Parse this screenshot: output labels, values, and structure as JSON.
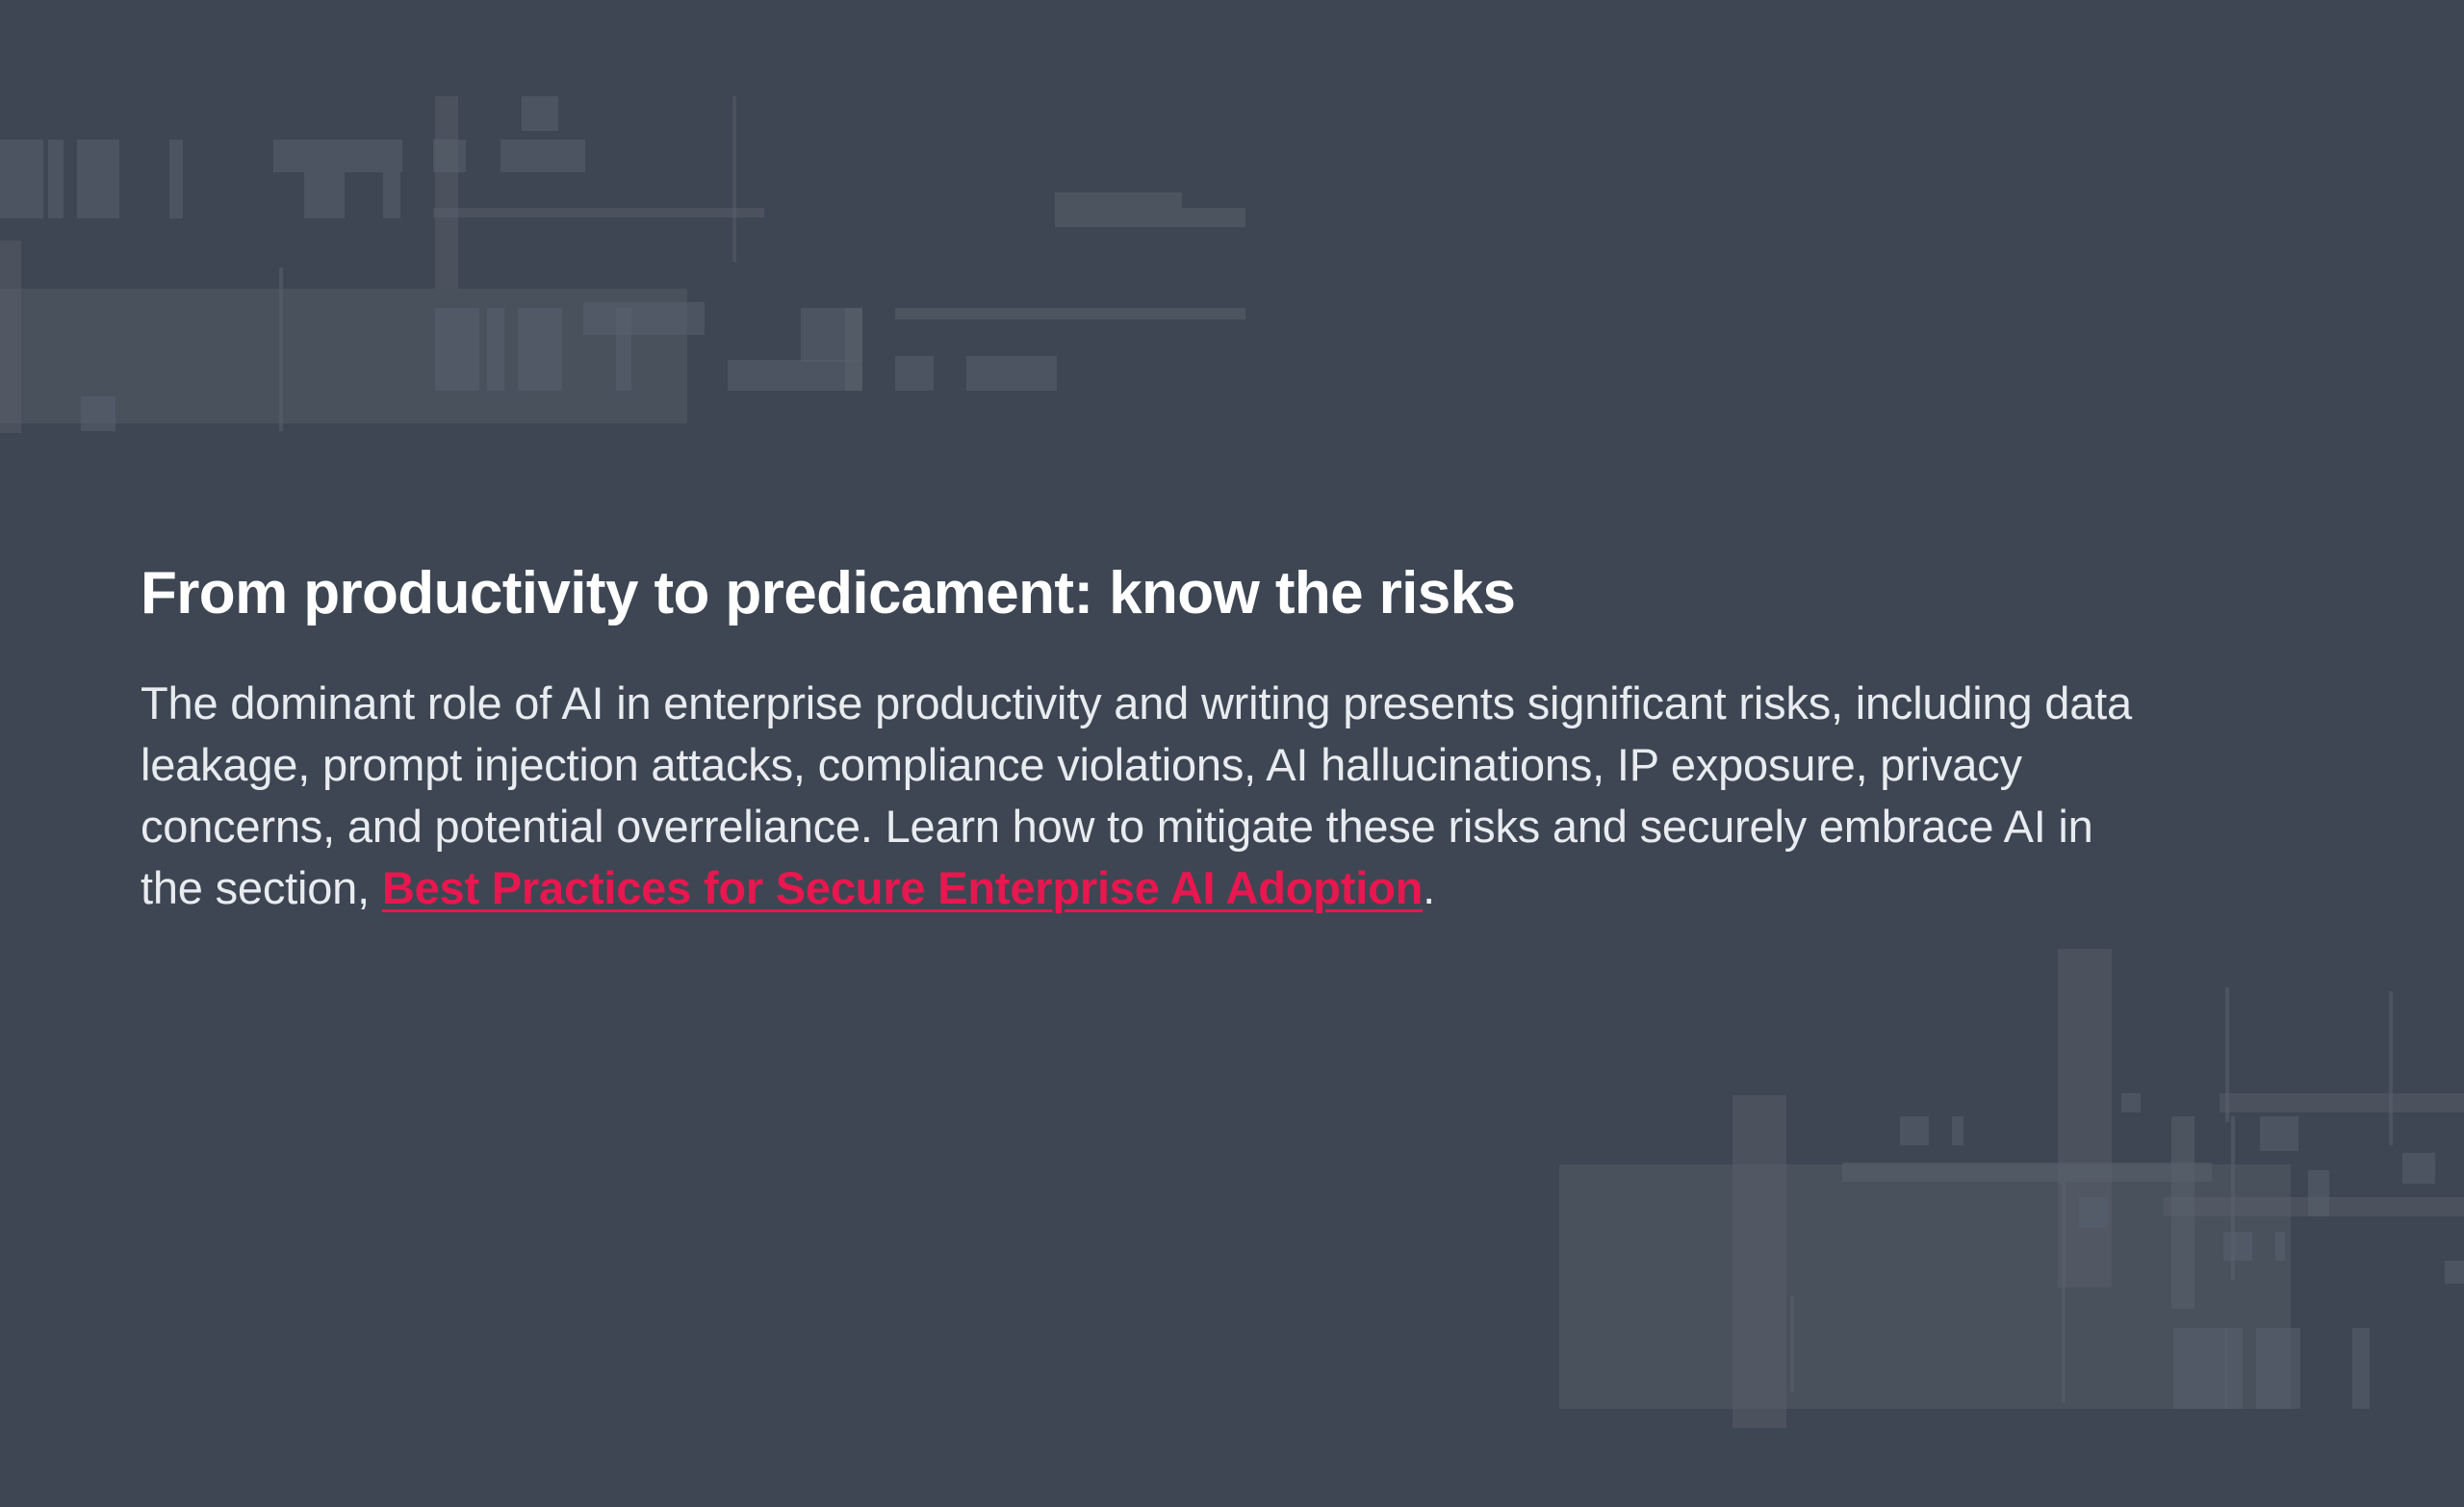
{
  "section": {
    "heading": "From productivity to predicament: know the risks",
    "body_lead": "The dominant role of AI in enterprise productivity and writing presents significant risks, including data leakage, prompt injection attacks, compliance violations, AI hallucinations, IP exposure, privacy concerns, and potential overreliance. Learn how to mitigate these risks and securely embrace AI in the section, ",
    "link_text": "Best Practices for Secure Enterprise AI Adoption",
    "body_tail": "."
  },
  "colors": {
    "background": "#3e4653",
    "heading_text": "#ffffff",
    "body_text": "#e8ebef",
    "link": "#e8174f",
    "decoration": "#5a616d"
  }
}
